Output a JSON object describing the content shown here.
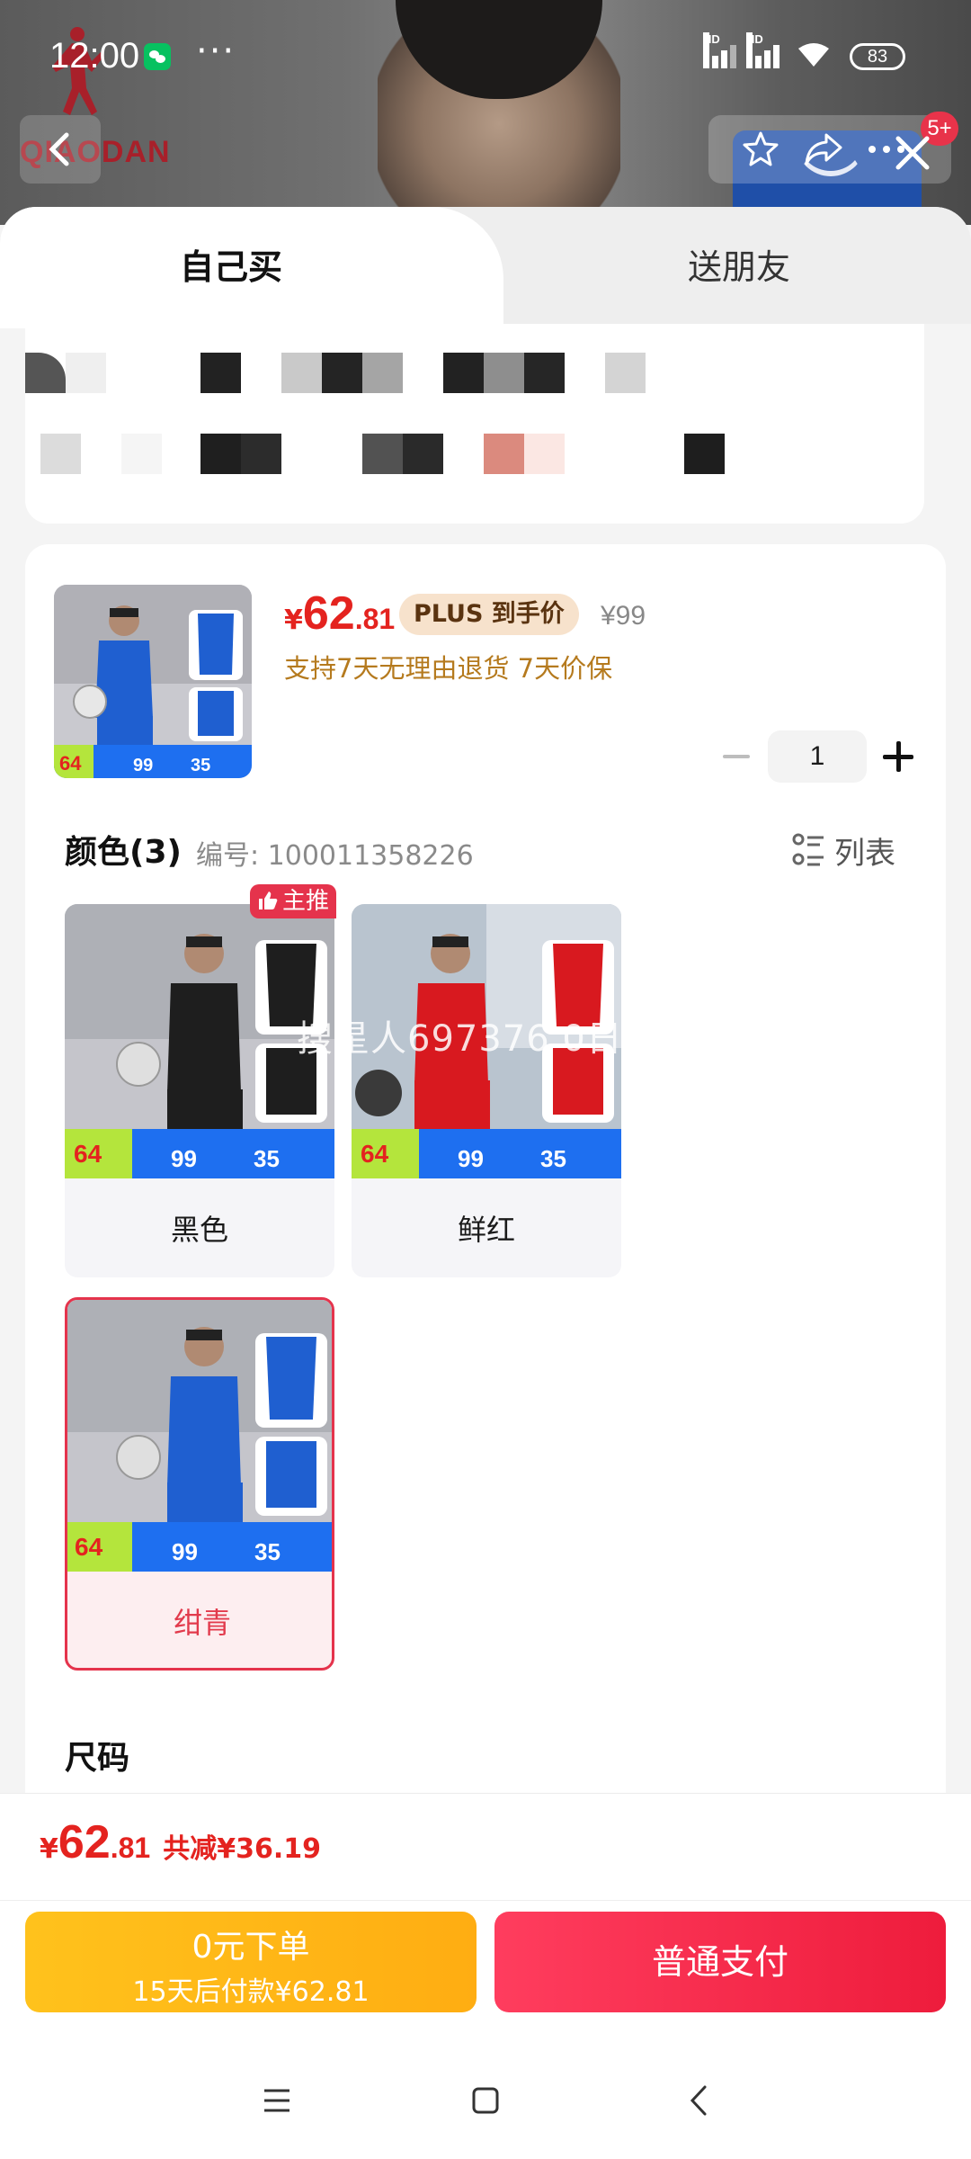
{
  "status_bar": {
    "time": "12:00",
    "more": "···",
    "hd1": "HD",
    "hd2": "HD",
    "battery": "83"
  },
  "header": {
    "brand_text": "QIAODAN",
    "cart_badge": "5+"
  },
  "tabs": [
    {
      "label": "自己买",
      "selected": true
    },
    {
      "label": "送朋友",
      "selected": false
    }
  ],
  "product": {
    "price_yen": "¥",
    "price_int": "62",
    "price_dec": ".81",
    "plus_badge": "PLUS 到手价",
    "original_price": "¥99",
    "service_tags": "支持7天无理由退货  7天价保",
    "quantity": "1",
    "thumb_promo": {
      "price_tag": "64",
      "value_a": "99",
      "value_b": "35"
    }
  },
  "color_section": {
    "heading": "颜色(3)",
    "code_label": "编号: 100011358226",
    "list_toggle": "列表",
    "recommend_badge": "主推",
    "watermark": "搜星人697376 0日",
    "options": [
      {
        "label": "黑色",
        "selected": false,
        "price_tag": "64",
        "value_a": "99",
        "value_b": "35"
      },
      {
        "label": "鲜红",
        "selected": false,
        "price_tag": "64",
        "value_a": "99",
        "value_b": "35"
      },
      {
        "label": "绀青",
        "selected": true,
        "price_tag": "64",
        "value_a": "99",
        "value_b": "35"
      }
    ]
  },
  "size_section": {
    "heading": "尺码"
  },
  "footer": {
    "total_yen": "¥",
    "total_int": "62",
    "total_dec": ".81",
    "total_saving": "共减¥36.19",
    "zero_button_line1": "0元下单",
    "zero_button_line2": "15天后付款¥62.81",
    "pay_button": "普通支付"
  },
  "colors": {
    "price_red": "#e4231f",
    "accent_pink": "#e5334c",
    "zero_button_gold": "#ffb516",
    "pay_button_red": "#f22b49",
    "service_gold": "#b57a1e",
    "jersey_blue": "#1f5fd0",
    "jersey_black": "#1e1e1e",
    "jersey_red": "#d8191f"
  }
}
